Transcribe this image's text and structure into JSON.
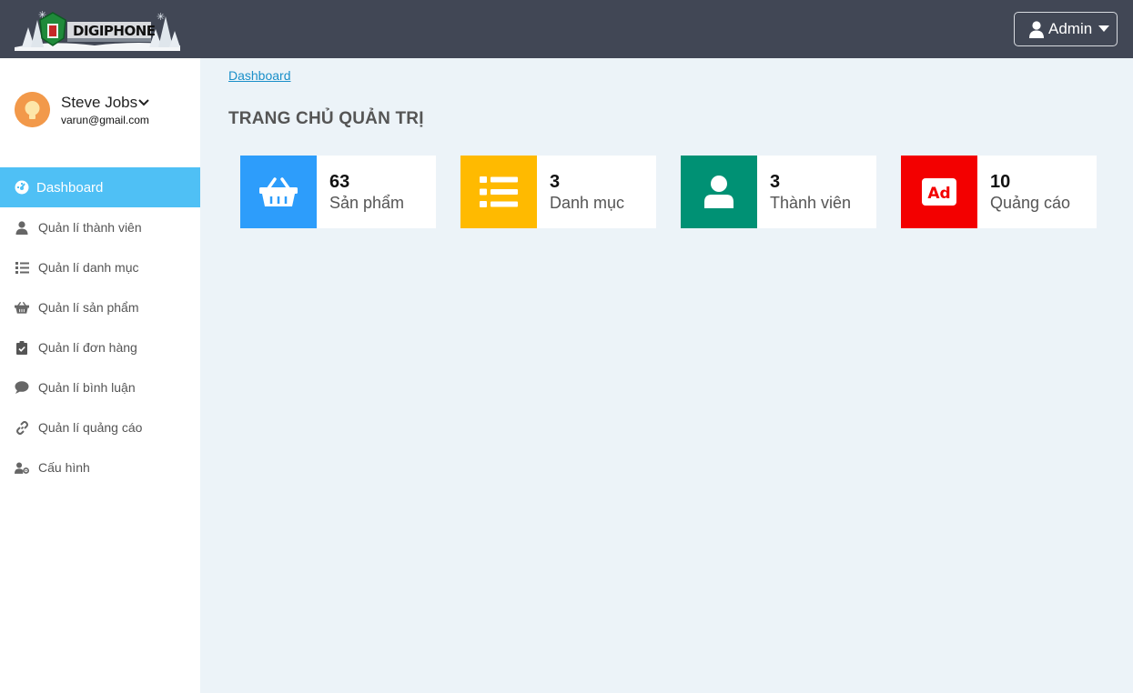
{
  "header": {
    "logo_text": "DIGIPHONE",
    "admin_label": "Admin"
  },
  "sidebar": {
    "user": {
      "name": "Steve Jobs",
      "email": "varun@gmail.com"
    },
    "items": [
      {
        "label": "Dashboard",
        "icon": "dashboard-icon",
        "active": true
      },
      {
        "label": "Quản lí thành viên",
        "icon": "user-icon"
      },
      {
        "label": "Quản lí danh mục",
        "icon": "list-icon"
      },
      {
        "label": "Quản lí sản phẩm",
        "icon": "basket-icon"
      },
      {
        "label": "Quản lí đơn hàng",
        "icon": "clipboard-check-icon"
      },
      {
        "label": "Quản lí bình luận",
        "icon": "comment-icon"
      },
      {
        "label": "Quản lí quảng cáo",
        "icon": "link-icon"
      },
      {
        "label": "Cấu hình",
        "icon": "user-cog-icon"
      }
    ]
  },
  "main": {
    "breadcrumb": "Dashboard",
    "title": "TRANG CHỦ QUẢN TRỊ",
    "cards": [
      {
        "value": "63",
        "label": "Sản phẩm",
        "color": "#2d9dfb",
        "icon": "basket-icon"
      },
      {
        "value": "3",
        "label": "Danh mục",
        "color": "#ffba00",
        "icon": "list-icon"
      },
      {
        "value": "3",
        "label": "Thành viên",
        "color": "#009174",
        "icon": "user-icon"
      },
      {
        "value": "10",
        "label": "Quảng cáo",
        "color": "#f30000",
        "icon": "ad-icon"
      }
    ]
  },
  "colors": {
    "topbar": "#414755",
    "sidebar_active": "#4fc0f5",
    "background": "#ecf3f8"
  }
}
